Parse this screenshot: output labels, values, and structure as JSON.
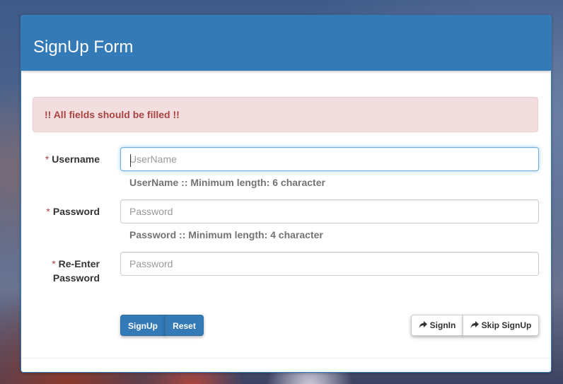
{
  "form": {
    "title": "SignUp Form",
    "alert": "!! All fields should be filled !!",
    "required_mark": "*",
    "fields": [
      {
        "label_line1": "Username",
        "label_line2": "",
        "placeholder": "UserName",
        "value": "",
        "help": "UserName :: Minimum length: 6 character",
        "focused": true
      },
      {
        "label_line1": "Password",
        "label_line2": "",
        "placeholder": "Password",
        "value": "",
        "help": "Password :: Minimum length: 4 character",
        "focused": false
      },
      {
        "label_line1": "Re-Enter",
        "label_line2": "Password",
        "placeholder": "Password",
        "value": "",
        "help": "",
        "focused": false
      }
    ],
    "buttons": {
      "signup": "SignUp",
      "reset": "Reset",
      "signin": "SignIn",
      "skip_signup": "Skip SignUp"
    },
    "icons": {
      "signin": "share-arrow-icon",
      "skip_signup": "share-arrow-icon"
    },
    "colors": {
      "primary": "#337ab7",
      "alert_bg": "#f2dede",
      "alert_text": "#a94442",
      "help_text": "#737373"
    }
  }
}
